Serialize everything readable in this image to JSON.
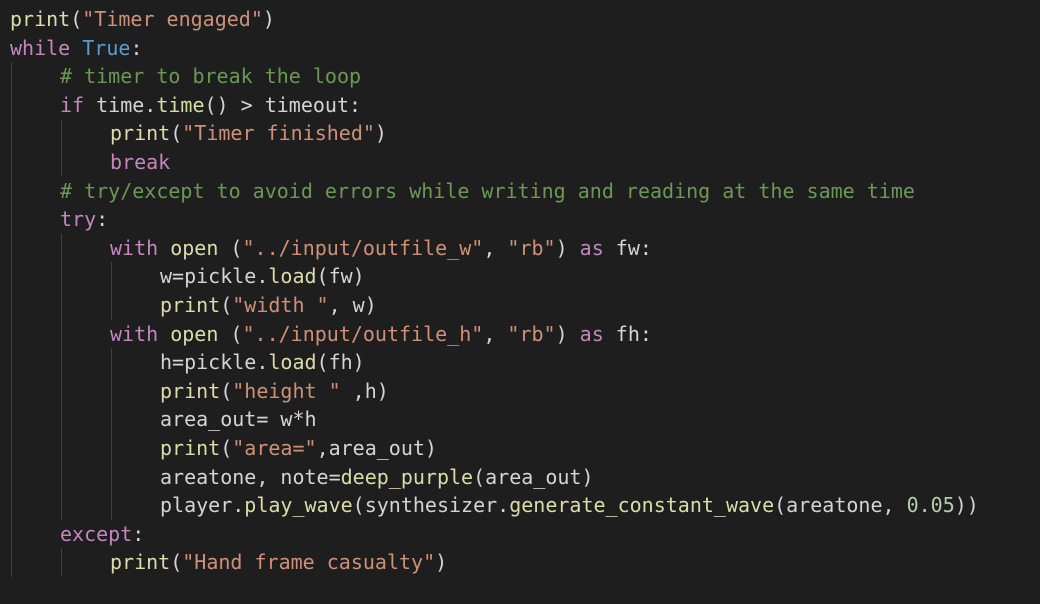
{
  "theme": {
    "background": "#1e1e1e",
    "default": "#d4d4d4",
    "keyword": "#c586c0",
    "builtin": "#569cd6",
    "function": "#dcdcaa",
    "string": "#ce9178",
    "comment": "#6a9955",
    "number": "#b5cea8",
    "indent_guide": "#404040"
  },
  "code": {
    "lines": [
      {
        "indent": 0,
        "tokens": [
          {
            "t": "fn",
            "v": "print"
          },
          {
            "t": "tx",
            "v": "("
          },
          {
            "t": "st",
            "v": "\"Timer engaged\""
          },
          {
            "t": "tx",
            "v": ")"
          }
        ]
      },
      {
        "indent": 0,
        "tokens": [
          {
            "t": "kw",
            "v": "while"
          },
          {
            "t": "tx",
            "v": " "
          },
          {
            "t": "bi",
            "v": "True"
          },
          {
            "t": "tx",
            "v": ":"
          }
        ]
      },
      {
        "indent": 1,
        "tokens": [
          {
            "t": "cm",
            "v": "# timer to break the loop"
          }
        ]
      },
      {
        "indent": 1,
        "tokens": [
          {
            "t": "kw",
            "v": "if"
          },
          {
            "t": "tx",
            "v": " time."
          },
          {
            "t": "fn",
            "v": "time"
          },
          {
            "t": "tx",
            "v": "() > timeout:"
          }
        ]
      },
      {
        "indent": 2,
        "tokens": [
          {
            "t": "fn",
            "v": "print"
          },
          {
            "t": "tx",
            "v": "("
          },
          {
            "t": "st",
            "v": "\"Timer finished\""
          },
          {
            "t": "tx",
            "v": ")"
          }
        ]
      },
      {
        "indent": 2,
        "tokens": [
          {
            "t": "kw",
            "v": "break"
          }
        ]
      },
      {
        "indent": 1,
        "tokens": [
          {
            "t": "cm",
            "v": "# try/except to avoid errors while writing and reading at the same time"
          }
        ]
      },
      {
        "indent": 1,
        "tokens": [
          {
            "t": "kw",
            "v": "try"
          },
          {
            "t": "tx",
            "v": ":"
          }
        ]
      },
      {
        "indent": 2,
        "tokens": [
          {
            "t": "kw",
            "v": "with"
          },
          {
            "t": "tx",
            "v": " "
          },
          {
            "t": "fn",
            "v": "open"
          },
          {
            "t": "tx",
            "v": " ("
          },
          {
            "t": "st",
            "v": "\"../input/outfile_w\""
          },
          {
            "t": "tx",
            "v": ", "
          },
          {
            "t": "st",
            "v": "\"rb\""
          },
          {
            "t": "tx",
            "v": ") "
          },
          {
            "t": "kw",
            "v": "as"
          },
          {
            "t": "tx",
            "v": " fw:"
          }
        ]
      },
      {
        "indent": 3,
        "tokens": [
          {
            "t": "tx",
            "v": "w=pickle."
          },
          {
            "t": "fn",
            "v": "load"
          },
          {
            "t": "tx",
            "v": "(fw)"
          }
        ]
      },
      {
        "indent": 3,
        "tokens": [
          {
            "t": "fn",
            "v": "print"
          },
          {
            "t": "tx",
            "v": "("
          },
          {
            "t": "st",
            "v": "\"width \""
          },
          {
            "t": "tx",
            "v": ", w)"
          }
        ]
      },
      {
        "indent": 2,
        "tokens": [
          {
            "t": "kw",
            "v": "with"
          },
          {
            "t": "tx",
            "v": " "
          },
          {
            "t": "fn",
            "v": "open"
          },
          {
            "t": "tx",
            "v": " ("
          },
          {
            "t": "st",
            "v": "\"../input/outfile_h\""
          },
          {
            "t": "tx",
            "v": ", "
          },
          {
            "t": "st",
            "v": "\"rb\""
          },
          {
            "t": "tx",
            "v": ") "
          },
          {
            "t": "kw",
            "v": "as"
          },
          {
            "t": "tx",
            "v": " fh:"
          }
        ]
      },
      {
        "indent": 3,
        "tokens": [
          {
            "t": "tx",
            "v": "h=pickle."
          },
          {
            "t": "fn",
            "v": "load"
          },
          {
            "t": "tx",
            "v": "(fh)"
          }
        ]
      },
      {
        "indent": 3,
        "tokens": [
          {
            "t": "fn",
            "v": "print"
          },
          {
            "t": "tx",
            "v": "("
          },
          {
            "t": "st",
            "v": "\"height \""
          },
          {
            "t": "tx",
            "v": " ,h)"
          }
        ]
      },
      {
        "indent": 3,
        "tokens": [
          {
            "t": "tx",
            "v": "area_out= w*h"
          }
        ]
      },
      {
        "indent": 3,
        "tokens": [
          {
            "t": "fn",
            "v": "print"
          },
          {
            "t": "tx",
            "v": "("
          },
          {
            "t": "st",
            "v": "\"area=\""
          },
          {
            "t": "tx",
            "v": ",area_out)"
          }
        ]
      },
      {
        "indent": 3,
        "tokens": [
          {
            "t": "tx",
            "v": "areatone, note="
          },
          {
            "t": "fn",
            "v": "deep_purple"
          },
          {
            "t": "tx",
            "v": "(area_out)"
          }
        ]
      },
      {
        "indent": 3,
        "tokens": [
          {
            "t": "tx",
            "v": "player."
          },
          {
            "t": "fn",
            "v": "play_wave"
          },
          {
            "t": "tx",
            "v": "(synthesizer."
          },
          {
            "t": "fn",
            "v": "generate_constant_wave"
          },
          {
            "t": "tx",
            "v": "(areatone, "
          },
          {
            "t": "nm",
            "v": "0.05"
          },
          {
            "t": "tx",
            "v": "))"
          }
        ]
      },
      {
        "indent": 1,
        "tokens": [
          {
            "t": "kw",
            "v": "except"
          },
          {
            "t": "tx",
            "v": ":"
          }
        ]
      },
      {
        "indent": 2,
        "tokens": [
          {
            "t": "fn",
            "v": "print"
          },
          {
            "t": "tx",
            "v": "("
          },
          {
            "t": "st",
            "v": "\"Hand frame casualty\""
          },
          {
            "t": "tx",
            "v": ")"
          }
        ]
      }
    ]
  }
}
